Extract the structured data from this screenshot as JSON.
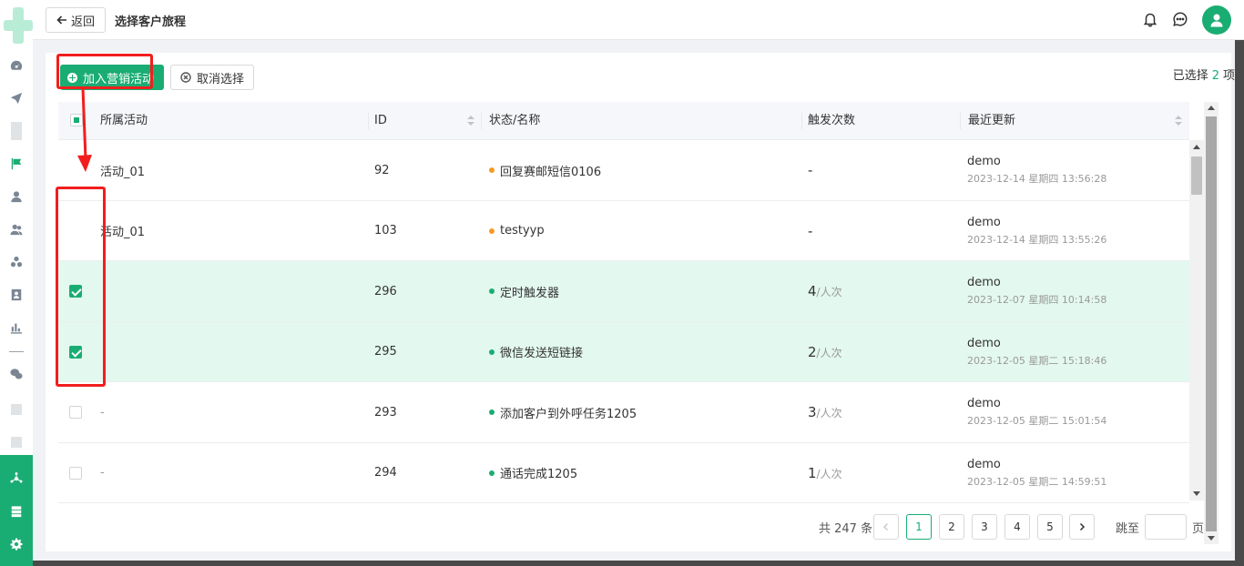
{
  "header": {
    "back_label": "返回",
    "title": "选择客户旅程"
  },
  "toolbar": {
    "add_label": "加入营销活动",
    "cancel_label": "取消选择",
    "selected_prefix": "已选择",
    "selected_count": "2",
    "selected_suffix": "项"
  },
  "table": {
    "columns": [
      "所属活动",
      "ID",
      "状态/名称",
      "触发次数",
      "最近更新"
    ],
    "rows": [
      {
        "activity": "活动_01",
        "id": "92",
        "status_color": "#f59a23",
        "name": "回复赛邮短信0106",
        "trigger_num": "-",
        "trigger_unit": "",
        "updater": "demo",
        "updated": "2023-12-14 星期四 13:56:28",
        "checked": false
      },
      {
        "activity": "活动_01",
        "id": "103",
        "status_color": "#f59a23",
        "name": "testyyp",
        "trigger_num": "-",
        "trigger_unit": "",
        "updater": "demo",
        "updated": "2023-12-14 星期四 13:55:26",
        "checked": false
      },
      {
        "activity": "",
        "id": "296",
        "status_color": "#1aad73",
        "name": "定时触发器",
        "trigger_num": "4",
        "trigger_unit": "/人次",
        "updater": "demo",
        "updated": "2023-12-07 星期四 10:14:58",
        "checked": true
      },
      {
        "activity": "",
        "id": "295",
        "status_color": "#1aad73",
        "name": "微信发送短链接",
        "trigger_num": "2",
        "trigger_unit": "/人次",
        "updater": "demo",
        "updated": "2023-12-05 星期二 15:18:46",
        "checked": true
      },
      {
        "activity": "-",
        "id": "293",
        "status_color": "#1aad73",
        "name": "添加客户到外呼任务1205",
        "trigger_num": "3",
        "trigger_unit": "/人次",
        "updater": "demo",
        "updated": "2023-12-05 星期二 15:01:54",
        "checked": false
      },
      {
        "activity": "-",
        "id": "294",
        "status_color": "#1aad73",
        "name": "通话完成1205",
        "trigger_num": "1",
        "trigger_unit": "/人次",
        "updater": "demo",
        "updated": "2023-12-05 星期二 14:59:51",
        "checked": false
      }
    ]
  },
  "pagination": {
    "total_text": "共 247 条",
    "pages": [
      "1",
      "2",
      "3",
      "4",
      "5"
    ],
    "current": "1",
    "jump_label": "跳至",
    "jump_unit": "页"
  },
  "colors": {
    "accent": "#1aad73",
    "warning": "#f59a23",
    "annotation": "#f21d1d"
  },
  "icons": {
    "sidebar": [
      "dashboard-icon",
      "send-icon",
      "flag-icon",
      "user-icon",
      "users-icon",
      "group-icon",
      "badge-icon",
      "bar-chart-icon",
      "wechat-icon",
      "hub-icon",
      "server-icon",
      "gear-icon"
    ],
    "header": [
      "arrow-left-icon",
      "bell-icon",
      "chat-icon",
      "user-avatar-icon"
    ]
  }
}
